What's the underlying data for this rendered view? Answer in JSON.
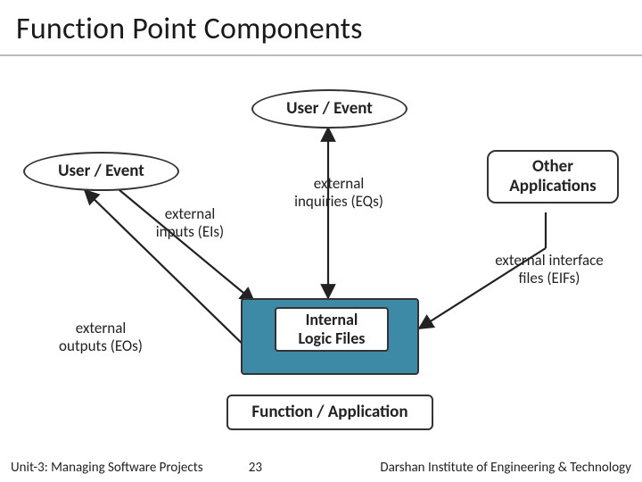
{
  "title": "Function Point Components",
  "nodes": {
    "user_event_top": "User / Event",
    "user_event_left": "User / Event",
    "other_apps": "Other\nApplications",
    "ilf_inner": "Internal\nLogic Files",
    "func_app": "Function / Application"
  },
  "labels": {
    "eis": "external\ninputs (EIs)",
    "eqs": "external\ninquiries (EQs)",
    "eos": "external\noutputs (EOs)",
    "eifs": "external interface\nfiles (EIFs)"
  },
  "footer": {
    "unit": "Unit-3: Managing Software Projects",
    "page": "23",
    "org": "Darshan Institute of Engineering & Technology"
  }
}
